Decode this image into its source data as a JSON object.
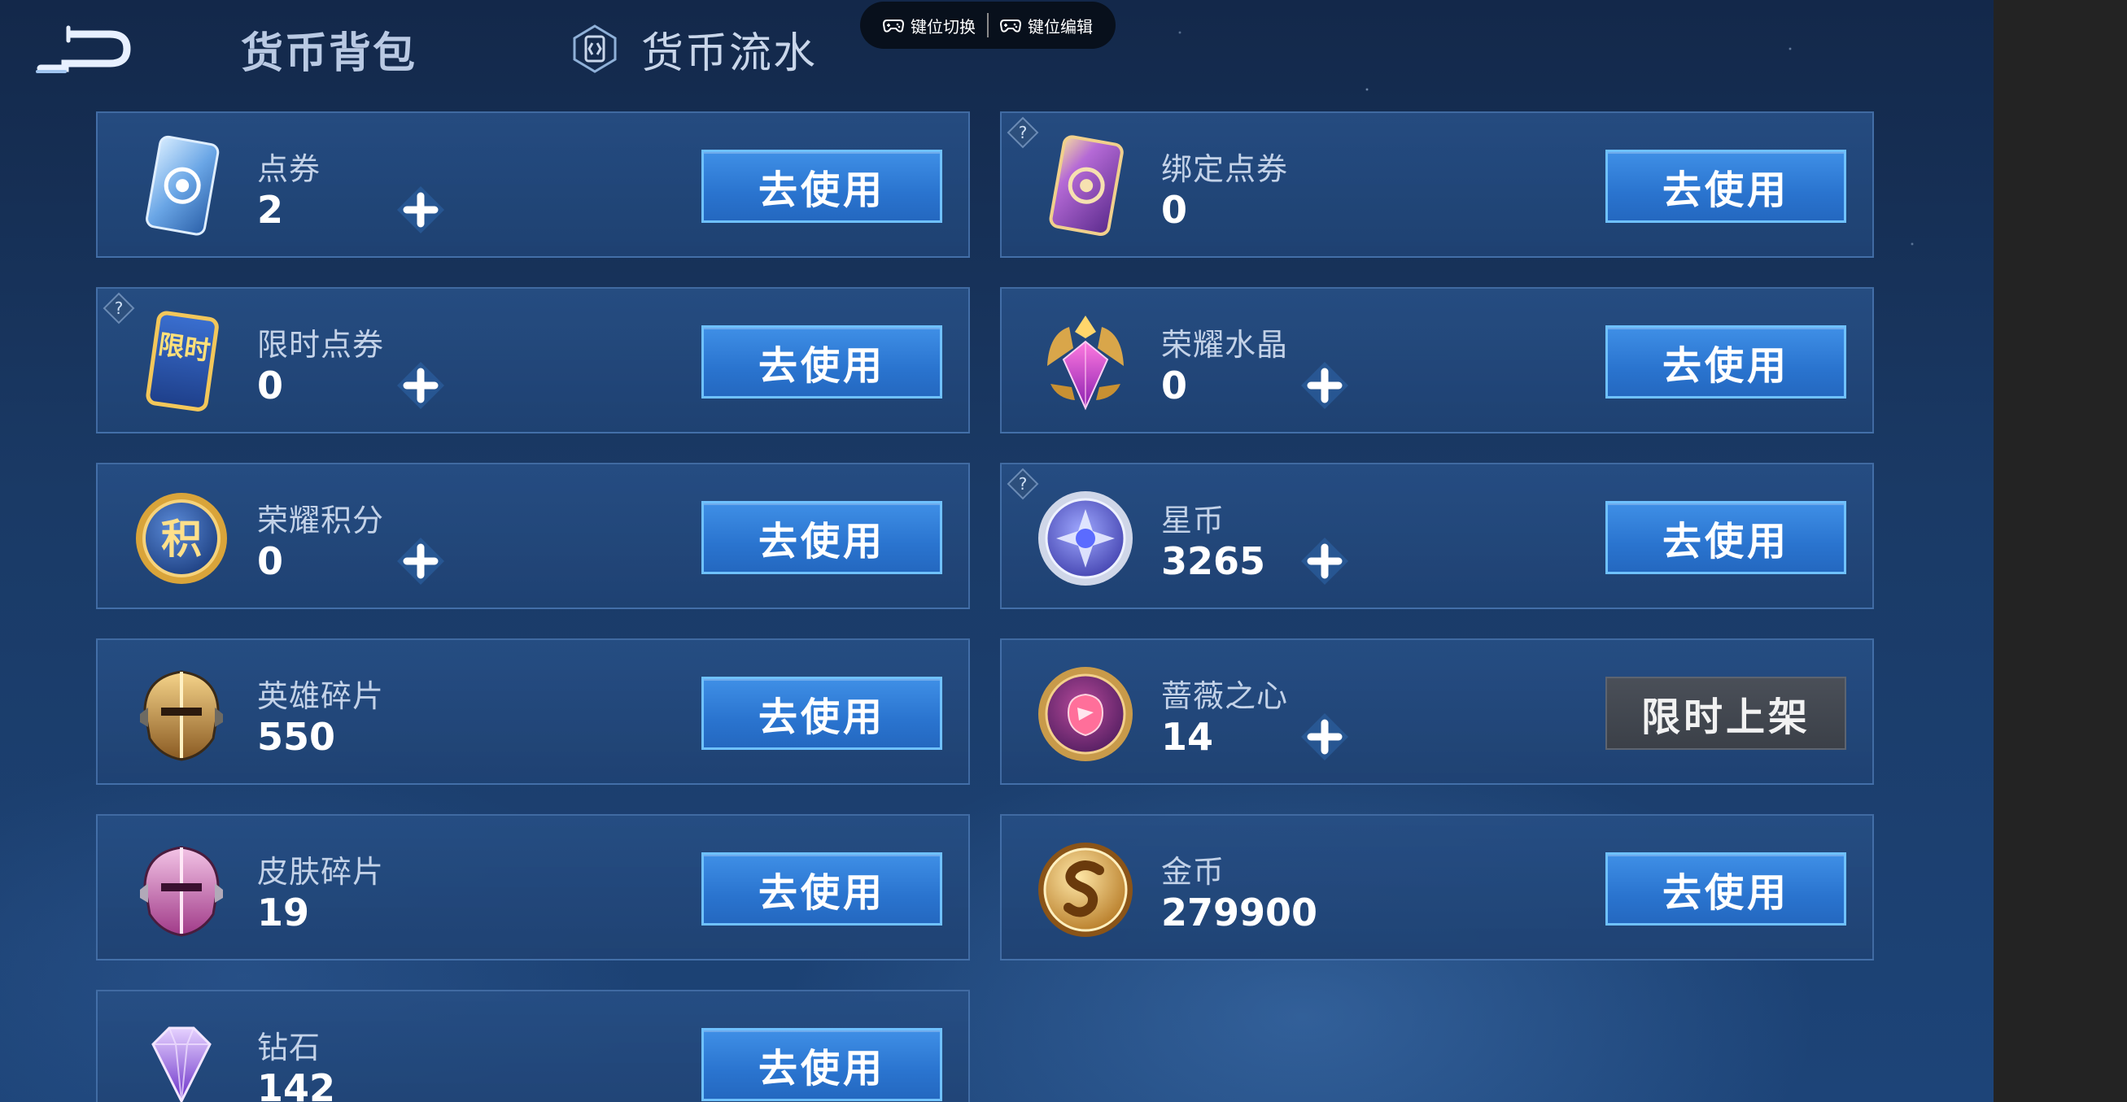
{
  "header": {
    "tab_active": "货币背包",
    "tab_flow": "货币流水"
  },
  "keybar": {
    "switch_label": "键位切换",
    "edit_label": "键位编辑"
  },
  "colors": {
    "button_blue": "#2a74cf",
    "button_border": "#6fc1ff",
    "button_gray": "#3b4048",
    "panel_bg": "#1f4273"
  },
  "currencies": [
    {
      "name": "点券",
      "value": "2",
      "action": "去使用",
      "icon": "voucher-card-icon"
    },
    {
      "name": "绑定点券",
      "value": "0",
      "action": "去使用",
      "icon": "bound-voucher-card-icon"
    },
    {
      "name": "限时点券",
      "value": "0",
      "action": "去使用",
      "icon": "limited-voucher-icon",
      "icon_text": "限时"
    },
    {
      "name": "荣耀水晶",
      "value": "0",
      "action": "去使用",
      "icon": "glory-crystal-icon"
    },
    {
      "name": "荣耀积分",
      "value": "0",
      "action": "去使用",
      "icon": "glory-points-icon",
      "icon_text": "积"
    },
    {
      "name": "星币",
      "value": "3265",
      "action": "去使用",
      "icon": "star-coin-icon"
    },
    {
      "name": "英雄碎片",
      "value": "550",
      "action": "去使用",
      "icon": "hero-fragment-icon"
    },
    {
      "name": "蔷薇之心",
      "value": "14",
      "action": "限时上架",
      "icon": "rose-heart-icon"
    },
    {
      "name": "皮肤碎片",
      "value": "19",
      "action": "去使用",
      "icon": "skin-fragment-icon"
    },
    {
      "name": "金币",
      "value": "279900",
      "action": "去使用",
      "icon": "gold-coin-icon"
    },
    {
      "name": "钻石",
      "value": "142",
      "action": "去使用",
      "icon": "diamond-icon"
    }
  ]
}
